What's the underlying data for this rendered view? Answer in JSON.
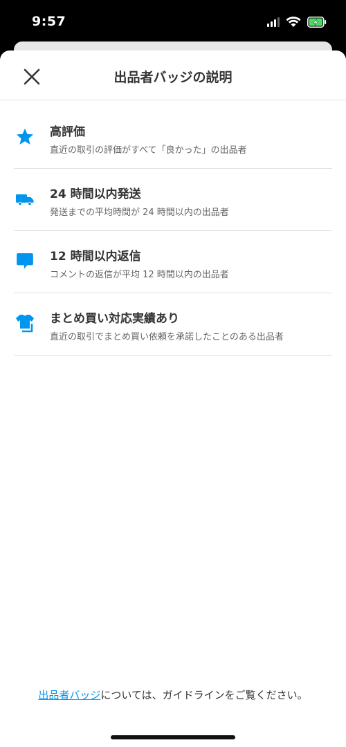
{
  "status_bar": {
    "time": "9:57"
  },
  "header": {
    "title": "出品者バッジの説明",
    "close_icon": "close-icon"
  },
  "badges": [
    {
      "icon": "star-icon",
      "title": "高評価",
      "description": "直近の取引の評価がすべて「良かった」の出品者"
    },
    {
      "icon": "truck-icon",
      "title": "24 時間以内発送",
      "description": "発送までの平均時間が 24 時間以内の出品者"
    },
    {
      "icon": "chat-bubble-icon",
      "title": "12 時間以内返信",
      "description": "コメントの返信が平均 12 時間以内の出品者"
    },
    {
      "icon": "bundle-clothes-icon",
      "title": "まとめ買い対応実績あり",
      "description": "直近の取引でまとめ買い依頼を承諾したことのある出品者"
    }
  ],
  "footer": {
    "link_text": "出品者バッジ",
    "rest_text": "については、ガイドラインをご覧ください。"
  },
  "colors": {
    "accent": "#0095EE",
    "title_text": "#333333",
    "desc_text": "#666666",
    "divider": "#E0E0E0",
    "battery": "#4CD964"
  }
}
